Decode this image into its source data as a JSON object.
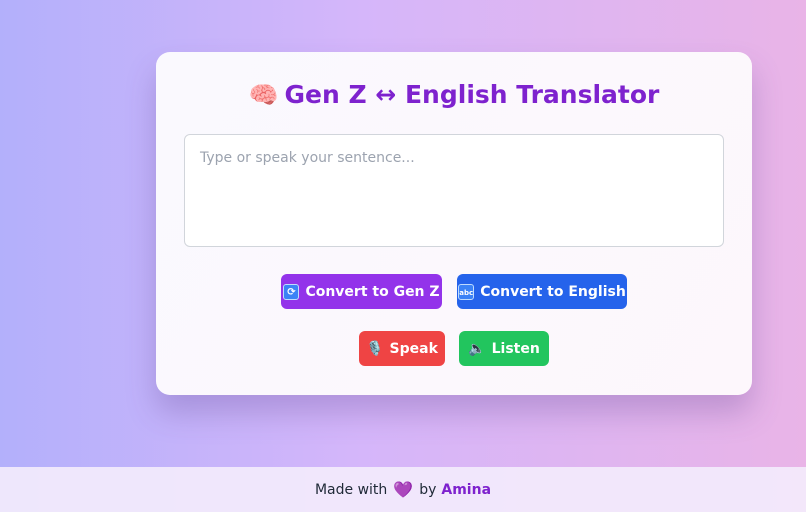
{
  "header": {
    "brain_icon": "🧠",
    "title": "Gen Z ↔ English Translator"
  },
  "input": {
    "placeholder": "Type or speak your sentence...",
    "value": ""
  },
  "buttons": {
    "to_genz": {
      "icon": "🔄",
      "label": "Convert to Gen Z",
      "color": "#9333ea"
    },
    "to_english": {
      "icon": "🔤",
      "label": "Convert to English",
      "color": "#2563eb"
    },
    "speak": {
      "icon": "🎙️",
      "label": "Speak",
      "color": "#ef4444"
    },
    "listen": {
      "icon": "🔈",
      "label": "Listen",
      "color": "#22c55e"
    }
  },
  "footer": {
    "made_with": "Made with",
    "heart": "💜",
    "by": "by",
    "author": "Amina"
  },
  "colors": {
    "accent": "#7e22ce"
  }
}
